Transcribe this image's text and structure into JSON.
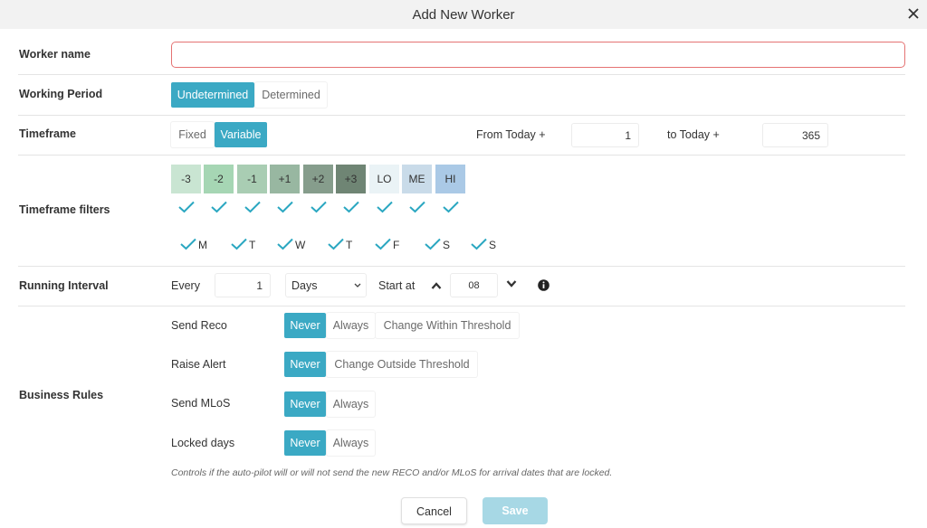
{
  "dialog": {
    "title": "Add New Worker"
  },
  "worker_name": {
    "label": "Worker name",
    "value": "",
    "placeholder": ""
  },
  "working_period": {
    "label": "Working Period",
    "options": [
      "Undetermined",
      "Determined"
    ],
    "selected": "Undetermined"
  },
  "timeframe": {
    "label": "Timeframe",
    "options": [
      "Fixed",
      "Variable"
    ],
    "selected": "Variable",
    "from_label": "From Today +",
    "from_value": "1",
    "to_label": "to Today +",
    "to_value": "365"
  },
  "timeframe_filters": {
    "label": "Timeframe filters",
    "chips": [
      {
        "label": "-3",
        "color": "#c9e5d2",
        "checked": true
      },
      {
        "label": "-2",
        "color": "#a6d6b4",
        "checked": true
      },
      {
        "label": "-1",
        "color": "#a9cdb3",
        "checked": true
      },
      {
        "label": "+1",
        "color": "#98b7a1",
        "checked": true
      },
      {
        "label": "+2",
        "color": "#869d8c",
        "checked": true
      },
      {
        "label": "+3",
        "color": "#6f8574",
        "checked": true
      },
      {
        "label": "LO",
        "color": "#eaf3f6",
        "checked": true
      },
      {
        "label": "ME",
        "color": "#c9dbe9",
        "checked": true
      },
      {
        "label": "HI",
        "color": "#aac9e6",
        "checked": true
      }
    ],
    "days": [
      {
        "label": "M",
        "checked": true
      },
      {
        "label": "T",
        "checked": true
      },
      {
        "label": "W",
        "checked": true
      },
      {
        "label": "T",
        "checked": true
      },
      {
        "label": "F",
        "checked": true
      },
      {
        "label": "S",
        "checked": true
      },
      {
        "label": "S",
        "checked": true
      }
    ]
  },
  "running_interval": {
    "label": "Running Interval",
    "every_label": "Every",
    "every_value": "1",
    "unit": "Days",
    "start_label": "Start at",
    "start_value": "08"
  },
  "business_rules": {
    "label": "Business Rules",
    "rules": [
      {
        "label": "Send Reco",
        "options": [
          "Never",
          "Always",
          "Change Within Threshold"
        ],
        "selected": "Never"
      },
      {
        "label": "Raise Alert",
        "options": [
          "Never",
          "Change Outside Threshold"
        ],
        "selected": "Never"
      },
      {
        "label": "Send MLoS",
        "options": [
          "Never",
          "Always"
        ],
        "selected": "Never"
      },
      {
        "label": "Locked days",
        "options": [
          "Never",
          "Always"
        ],
        "selected": "Never"
      }
    ],
    "note": "Controls if the auto-pilot will or will not send the new RECO and/or MLoS for arrival dates that are locked."
  },
  "footer": {
    "cancel": "Cancel",
    "save": "Save"
  },
  "colors": {
    "accent": "#3ba9c4",
    "check": "#2aa7c1",
    "error_border": "#e57373",
    "save_disabled": "#a7d8e5"
  },
  "icons": {
    "close": "close-icon",
    "up": "chevron-up-icon",
    "down": "chevron-down-icon",
    "info": "info-icon",
    "check": "check-icon",
    "select": "caret-down-icon"
  }
}
